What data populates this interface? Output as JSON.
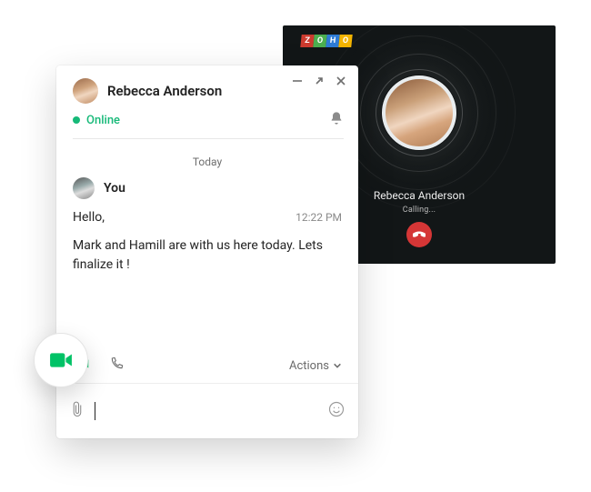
{
  "brand": {
    "name": "ZOHO",
    "letters": [
      "Z",
      "O",
      "H",
      "O"
    ]
  },
  "call": {
    "contact_name": "Rebecca Anderson",
    "status": "Calling...",
    "hangup_label": "hangup"
  },
  "chat": {
    "contact_name": "Rebecca Anderson",
    "presence": {
      "label": "Online",
      "color": "#16b978"
    },
    "date_separator": "Today",
    "sender_label": "You",
    "messages": [
      {
        "text": "Hello,",
        "time": "12:22 PM"
      },
      {
        "text": "Mark and Hamill are with us here today. Lets finalize it !",
        "time": ""
      }
    ],
    "actions_label": "Actions",
    "attach_aria": "attach",
    "emoji_aria": "emoji",
    "video_aria": "video-call",
    "audio_aria": "audio-call",
    "notifications_aria": "notifications"
  },
  "window_controls": {
    "minimize": "minimize",
    "expand": "expand",
    "close": "close"
  },
  "colors": {
    "accent_green": "#00c266",
    "status_green": "#16b978",
    "hangup_red": "#d53636"
  }
}
